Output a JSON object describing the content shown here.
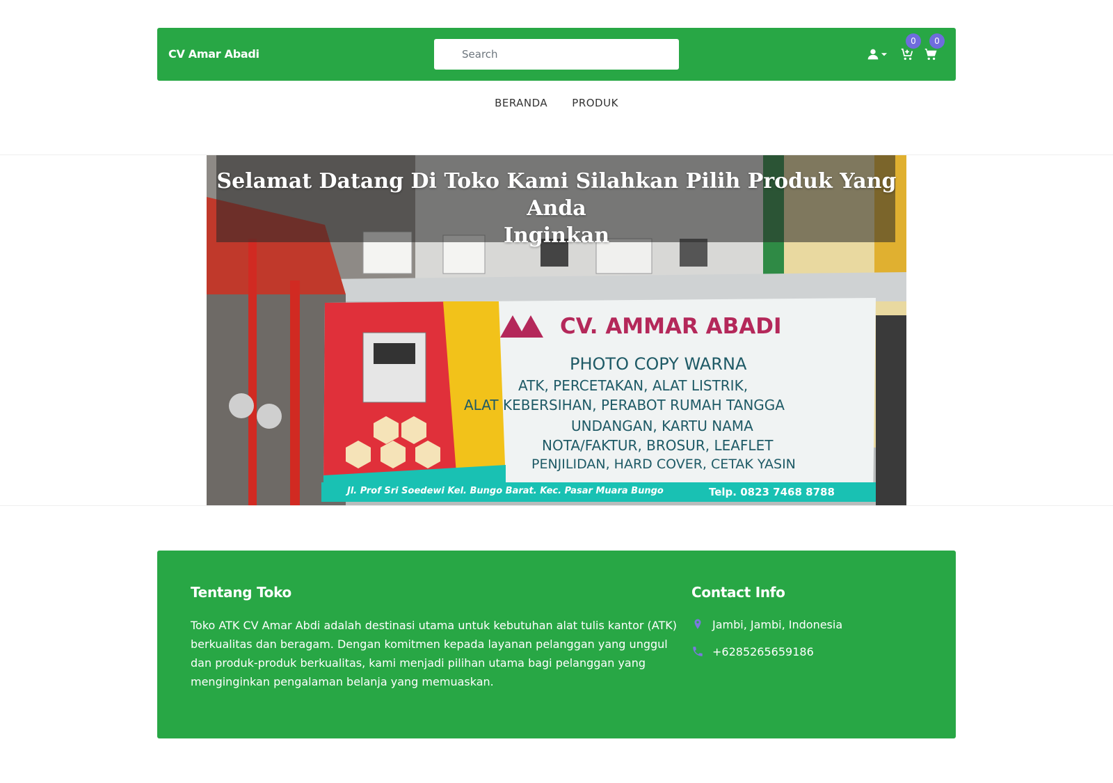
{
  "header": {
    "brand": "CV Amar Abadi",
    "search": {
      "placeholder": "Search",
      "value": ""
    },
    "icons": [
      {
        "name": "user-icon"
      },
      {
        "name": "caret-down-icon"
      },
      {
        "name": "cart-add-icon",
        "badge": "0"
      },
      {
        "name": "cart-icon",
        "badge": "0"
      }
    ]
  },
  "nav": {
    "items": [
      "BERANDA",
      "PRODUK"
    ]
  },
  "hero": {
    "title_line1": "Selamat Datang Di Toko Kami Silahkan Pilih Produk Yang Anda",
    "title_line2": "Inginkan",
    "banner": {
      "company": "CV. AMMAR ABADI",
      "line1": "PHOTO COPY WARNA",
      "line2": "ATK, PERCETAKAN, ALAT LISTRIK,",
      "line3": "ALAT KEBERSIHAN, PERABOT RUMAH TANGGA",
      "line4": "UNDANGAN, KARTU NAMA",
      "line5": "NOTA/FAKTUR, BROSUR, LEAFLET",
      "line6": "PENJILIDAN, HARD COVER, CETAK YASIN",
      "address": "Jl. Prof Sri Soedewi Kel. Bungo Barat. Kec. Pasar Muara Bungo",
      "phone": "Telp. 0823 7468 8788"
    }
  },
  "footer": {
    "about_title": "Tentang Toko",
    "about_text": "Toko ATK CV Amar Abdi adalah destinasi utama untuk kebutuhan alat tulis kantor (ATK) berkualitas dan beragam. Dengan komitmen kepada layanan pelanggan yang unggul dan produk-produk berkualitas, kami menjadi pilihan utama bagi pelanggan yang menginginkan pengalaman belanja yang memuaskan.",
    "contact_title": "Contact Info",
    "location": "Jambi, Jambi, Indonesia",
    "phone": "+6285265659186"
  },
  "colors": {
    "primary": "#28a745",
    "badge": "#6f6cdd",
    "contact_icon": "#7b78e0"
  }
}
